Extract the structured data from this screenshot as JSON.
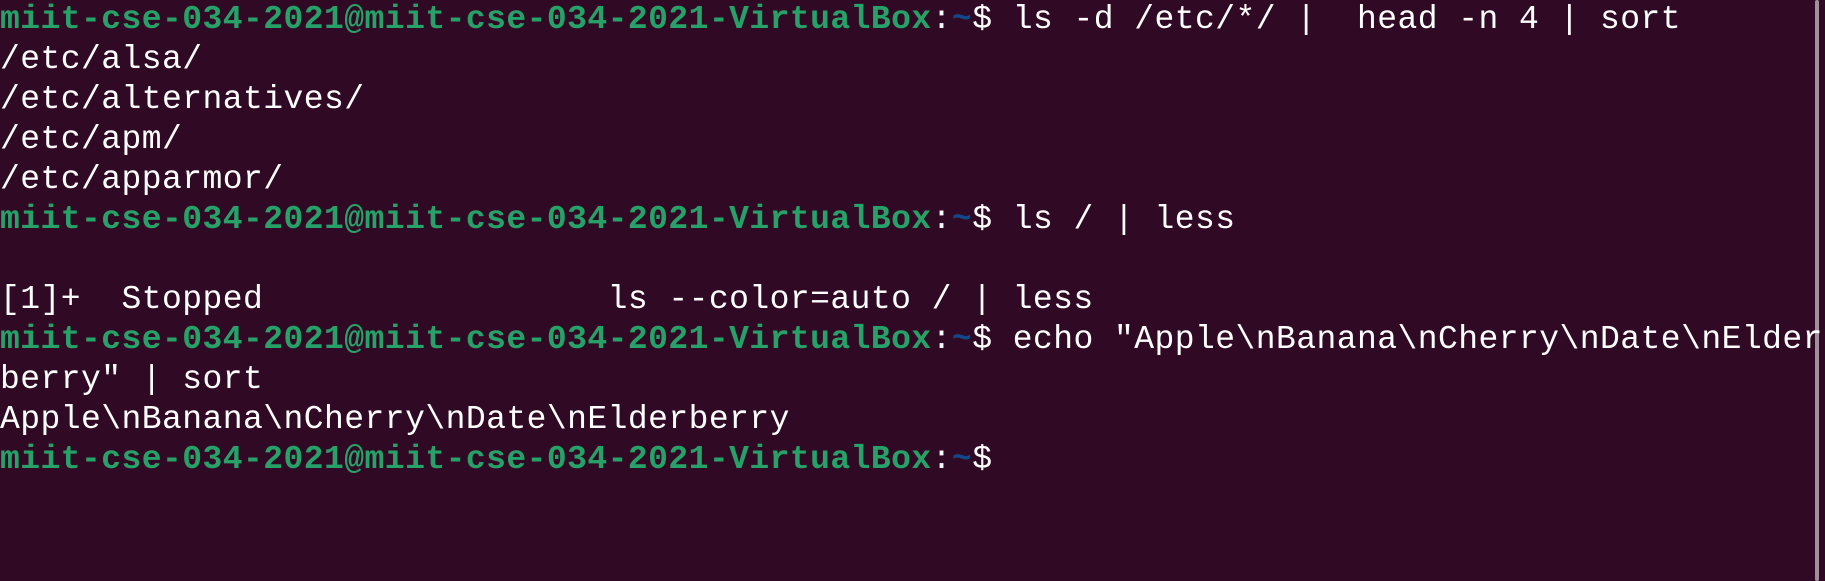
{
  "terminal": {
    "colors": {
      "background": "#300a24",
      "prompt_user": "#26a269",
      "prompt_path": "#12488b",
      "text": "#ffffff"
    },
    "prompt": {
      "user_host": "miit-cse-034-2021@miit-cse-034-2021-VirtualBox",
      "separator": ":",
      "path": "~",
      "symbol": "$"
    },
    "lines": [
      {
        "type": "prompt",
        "command": " ls -d /etc/*/ |  head -n 4 | sort"
      },
      {
        "type": "output",
        "text": "/etc/alsa/"
      },
      {
        "type": "output",
        "text": "/etc/alternatives/"
      },
      {
        "type": "output",
        "text": "/etc/apm/"
      },
      {
        "type": "output",
        "text": "/etc/apparmor/"
      },
      {
        "type": "prompt",
        "command": " ls / | less"
      },
      {
        "type": "output",
        "text": ""
      },
      {
        "type": "output",
        "text": "[1]+  Stopped                 ls --color=auto / | less"
      },
      {
        "type": "prompt",
        "command": " echo \"Apple\\nBanana\\nCherry\\nDate\\nElder"
      },
      {
        "type": "output",
        "text": "berry\" | sort"
      },
      {
        "type": "output",
        "text": "Apple\\nBanana\\nCherry\\nDate\\nElderberry"
      },
      {
        "type": "prompt",
        "command": ""
      }
    ]
  }
}
